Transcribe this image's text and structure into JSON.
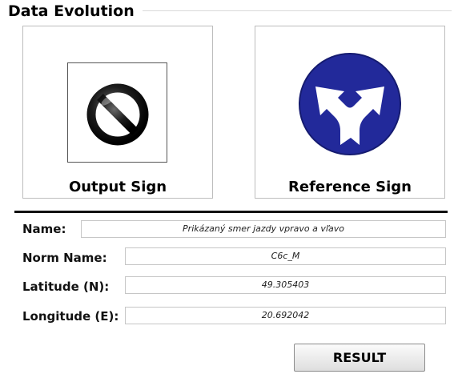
{
  "group": {
    "title": "Data Evolution"
  },
  "panels": {
    "output": {
      "label": "Output Sign"
    },
    "reference": {
      "label": "Reference Sign"
    }
  },
  "fields": {
    "name": {
      "label": "Name:",
      "value": "Prikázaný smer jazdy vpravo a vľavo"
    },
    "norm_name": {
      "label": "Norm Name:",
      "value": "C6c_M"
    },
    "latitude": {
      "label": "Latitude (N):",
      "value": "49.305403"
    },
    "longitude": {
      "label": "Longitude (E):",
      "value": "20.692042"
    }
  },
  "result_button": {
    "label": "RESULT"
  },
  "icons": {
    "output": "no-entry-prohibition-icon",
    "reference": "mandatory-left-right-arrows-icon"
  },
  "colors": {
    "reference_sign_blue": "#22299a"
  }
}
